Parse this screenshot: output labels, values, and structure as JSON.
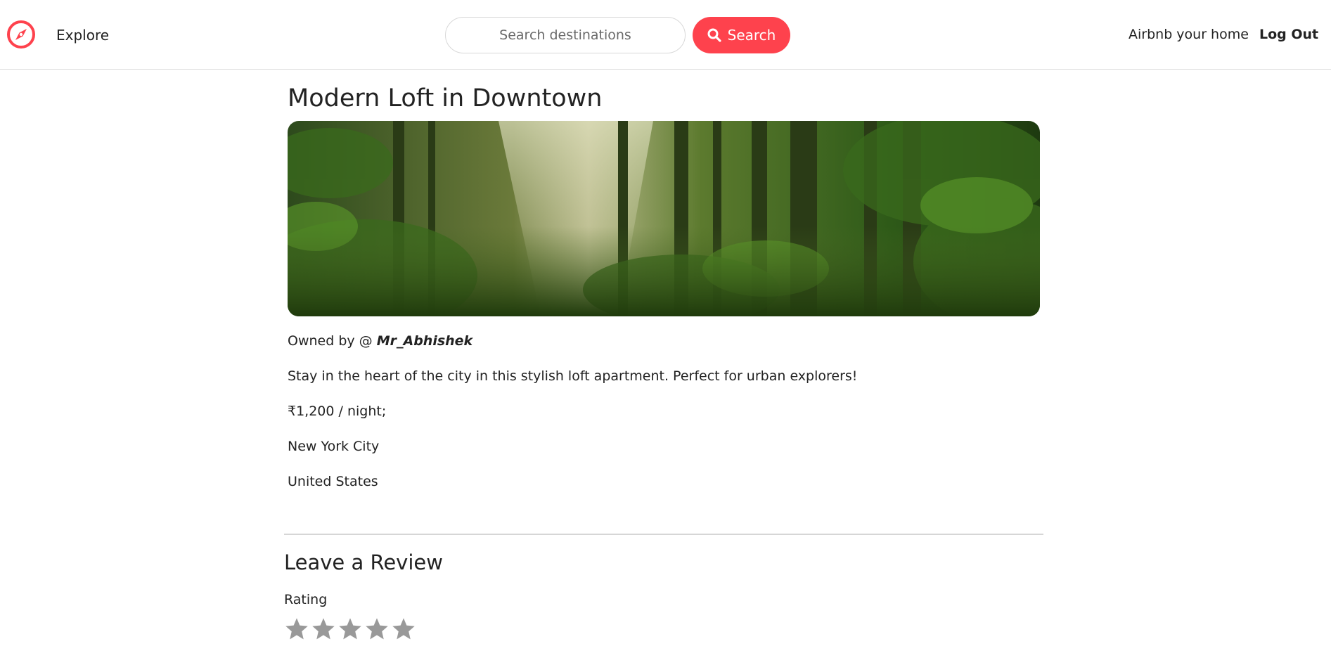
{
  "nav": {
    "explore_label": "Explore",
    "search_placeholder": "Search destinations",
    "search_button_label": "Search",
    "host_label": "Airbnb your home",
    "logout_label": "Log Out"
  },
  "listing": {
    "title": "Modern Loft in Downtown",
    "owner_prefix": "Owned by @ ",
    "owner": "Mr_Abhishek",
    "description": "Stay in the heart of the city in this stylish loft apartment. Perfect for urban explorers!",
    "price": "₹1,200 / night;",
    "location": "New York City",
    "country": "United States"
  },
  "review": {
    "heading": "Leave a Review",
    "rating_label": "Rating",
    "star_count": 5
  },
  "colors": {
    "brand": "#fe424d",
    "text": "#222222",
    "star": "#999999"
  },
  "icons": {
    "brand": "compass-icon",
    "search": "search-icon",
    "star": "star-icon"
  }
}
